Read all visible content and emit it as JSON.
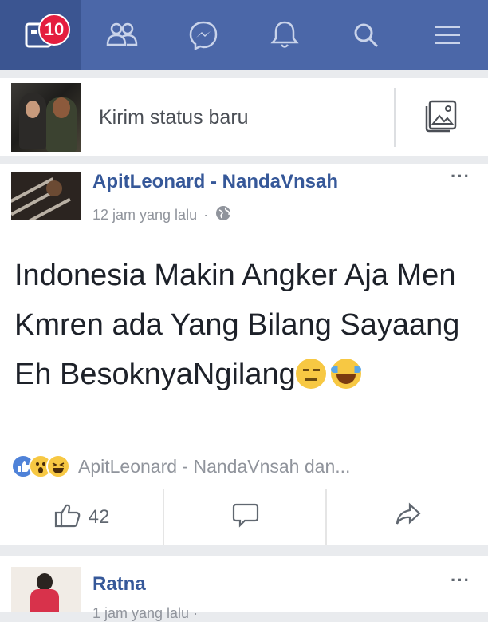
{
  "nav": {
    "items": [
      {
        "name": "news-feed",
        "icon": "news-feed-icon"
      },
      {
        "name": "friends",
        "icon": "friends-icon"
      },
      {
        "name": "messenger",
        "icon": "messenger-icon"
      },
      {
        "name": "notifications",
        "icon": "bell-icon"
      },
      {
        "name": "search",
        "icon": "search-icon"
      },
      {
        "name": "menu",
        "icon": "hamburger-menu-icon"
      }
    ],
    "badge_count": "10",
    "colors": {
      "bar": "#4b67a8",
      "active": "#3b5591",
      "badge": "#e41e3f"
    }
  },
  "composer": {
    "prompt": "Kirim status baru",
    "photo_icon": "photo-icon"
  },
  "post": {
    "author": "ApitLeonard - NandaVnsah",
    "time": "12 jam yang lalu",
    "separator": "·",
    "privacy_icon": "globe-icon",
    "more": "···",
    "body": "Indonesia Makin Angker Aja Men Kmren ada Yang Bilang Sayaang Eh BesoknyaNgilang",
    "reaction_icons": [
      "like",
      "wow",
      "haha"
    ],
    "reactors": "ApitLeonard - NandaVnsah dan...",
    "like_count": "42"
  },
  "post2": {
    "author": "Ratna",
    "meta": "1 jam yang lalu ·",
    "more": "···"
  }
}
